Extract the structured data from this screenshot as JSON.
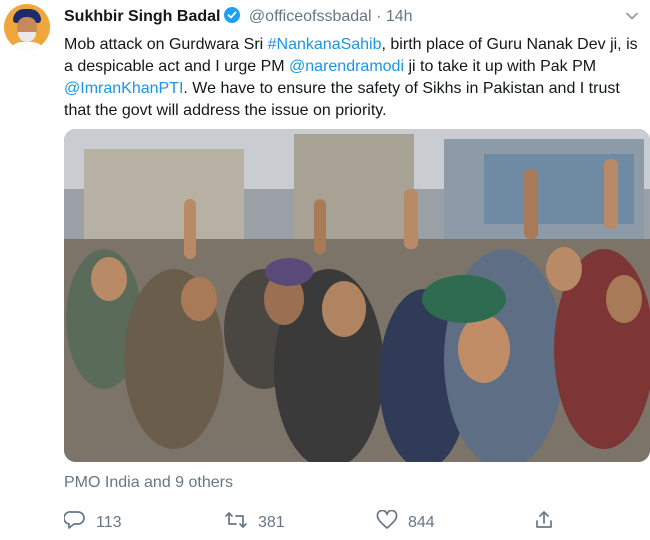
{
  "tweet": {
    "author_name": "Sukhbir Singh Badal",
    "handle": "@officeofssbadal",
    "separator": "·",
    "time": "14h",
    "text_parts": {
      "p1": "Mob attack on Gurdwara Sri ",
      "hashtag": "#NankanaSahib",
      "p2": ", birth place of Guru Nanak Dev ji, is a despicable act and I urge PM ",
      "mention1": "@narendramodi",
      "p3": " ji to take it up with Pak PM ",
      "mention2": "@ImranKhanPTI",
      "p4": ". We have to ensure the safety of Sikhs in Pakistan and I trust that the govt will address the issue on priority."
    },
    "liked_by": "PMO India and 9 others",
    "counts": {
      "replies": "113",
      "retweets": "381",
      "likes": "844"
    }
  },
  "icons": {
    "verified": "verified-badge-icon",
    "menu": "chevron-down-icon",
    "reply": "reply-icon",
    "retweet": "retweet-icon",
    "like": "heart-icon",
    "share": "share-icon"
  },
  "colors": {
    "link": "#1b95e0",
    "verified": "#1da1f2",
    "secondary": "#657786",
    "text": "#14171a"
  }
}
